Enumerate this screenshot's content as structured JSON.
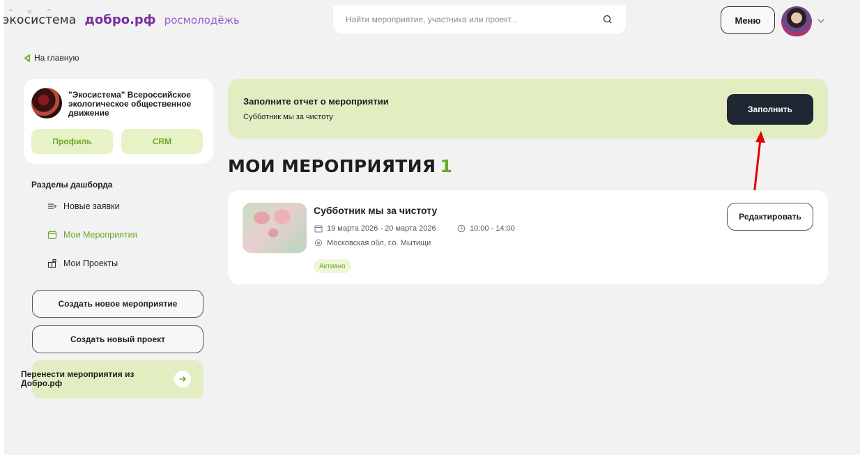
{
  "header": {
    "logo_eco": "экосистема",
    "logo_dobro": "добро.рф",
    "logo_rosmol": "росмолодёжь",
    "search_placeholder": "Найти мероприятие, участника или проект...",
    "menu_label": "Меню"
  },
  "back_link": "На главную",
  "sidebar": {
    "org_name": "\"Экосистема\" Всероссийское экологическое общественное движение",
    "profile_label": "Профиль",
    "crm_label": "CRM",
    "section_title": "Разделы дашборда",
    "nav": [
      {
        "label": "Новые заявки",
        "icon": "new-requests-icon"
      },
      {
        "label": "Мои Мероприятия",
        "icon": "calendar-icon",
        "active": true
      },
      {
        "label": "Мои Проекты",
        "icon": "projects-icon"
      }
    ],
    "create_event_label": "Создать новое мероприятие",
    "create_project_label": "Создать новый проект",
    "transfer_label": "Перенести мероприятия из Добро.рф"
  },
  "report": {
    "title": "Заполните отчет о мероприятии",
    "subtitle": "Субботник мы за чистоту",
    "button_label": "Заполнить"
  },
  "events": {
    "title": "МОИ МЕРОПРИЯТИЯ",
    "count": "1",
    "items": [
      {
        "name": "Субботник мы за чистоту",
        "date": "19 марта 2026 - 20 марта 2026",
        "time": "10:00 - 14:00",
        "place": "Московская обл, г.о. Мытищи",
        "status": "Активно",
        "edit_label": "Редактировать"
      }
    ]
  },
  "colors": {
    "accent_green": "#6aa82a",
    "light_green": "#e2eec2",
    "dark_button": "#1f2733",
    "annotation_red": "#e00000"
  }
}
